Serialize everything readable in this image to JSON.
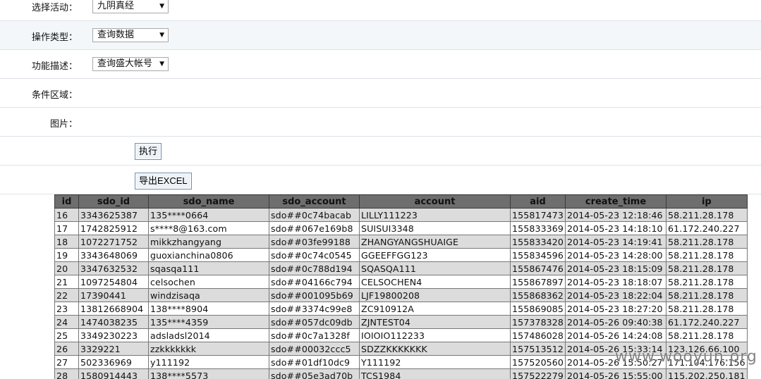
{
  "form": {
    "activity": {
      "label": "选择活动：",
      "value": "九阴真经"
    },
    "op_type": {
      "label": "操作类型：",
      "value": "查询数据"
    },
    "func_desc": {
      "label": "功能描述：",
      "value": "查询盛大帐号"
    },
    "condition": {
      "label": "条件区域："
    },
    "image": {
      "label": "图片："
    },
    "execute_label": "执行",
    "export_label": "导出EXCEL",
    "arrow_icon": "triangle-down-icon"
  },
  "table": {
    "headers": [
      "id",
      "sdo_id",
      "sdo_name",
      "sdo_account",
      "account",
      "aid",
      "create_time",
      "ip"
    ],
    "rows": [
      [
        "16",
        "3343625387",
        "135****0664",
        "sdo##0c74bacab",
        "LILLY111223",
        "155817473",
        "2014-05-23 12:18:46",
        "58.211.28.178"
      ],
      [
        "17",
        "1742825912",
        "s****8@163.com",
        "sdo##067e169b8",
        "SUISUI3348",
        "155833369",
        "2014-05-23 14:18:10",
        "61.172.240.227"
      ],
      [
        "18",
        "1072271752",
        "mikkzhangyang",
        "sdo##03fe99188",
        "ZHANGYANGSHUAIGE",
        "155833420",
        "2014-05-23 14:19:41",
        "58.211.28.178"
      ],
      [
        "19",
        "3343648069",
        "guoxianchina0806",
        "sdo##0c74c0545",
        "GGEEFFGG123",
        "155834596",
        "2014-05-23 14:28:00",
        "58.211.28.178"
      ],
      [
        "20",
        "3347632532",
        "sqasqa111",
        "sdo##0c788d194",
        "SQASQA111",
        "155867476",
        "2014-05-23 18:15:09",
        "58.211.28.178"
      ],
      [
        "21",
        "1097254804",
        "celsochen",
        "sdo##04166c794",
        "CELSOCHEN4",
        "155867897",
        "2014-05-23 18:18:07",
        "58.211.28.178"
      ],
      [
        "22",
        "17390441",
        "windzisaqa",
        "sdo##001095b69",
        "LJF19800208",
        "155868362",
        "2014-05-23 18:22:04",
        "58.211.28.178"
      ],
      [
        "23",
        "13812668904",
        "138****8904",
        "sdo##3374c99e8",
        "ZC910912A",
        "155869085",
        "2014-05-23 18:27:20",
        "58.211.28.178"
      ],
      [
        "24",
        "1474038235",
        "135****4359",
        "sdo##057dc09db",
        "ZJNTEST04",
        "157378328",
        "2014-05-26 09:40:38",
        "61.172.240.227"
      ],
      [
        "25",
        "3349230223",
        "adsladsl2014",
        "sdo##0c7a1328f",
        "IOIOIO112233",
        "157486028",
        "2014-05-26 14:24:08",
        "58.211.28.178"
      ],
      [
        "26",
        "3329221",
        "zzkkkkkkk",
        "sdo##00032ccc5",
        "SDZZKKKKKKK",
        "157513512",
        "2014-05-26 15:33:14",
        "123.126.66.100"
      ],
      [
        "27",
        "502336969",
        "y111192",
        "sdo##01df10dc9",
        "Y111192",
        "157520560",
        "2014-05-26 15:50:27",
        "171.104.176.156"
      ],
      [
        "28",
        "1580914443",
        "138****5573",
        "sdo##05e3ad70b",
        "TCS1984",
        "157522279",
        "2014-05-26 15:55:00",
        "115.202.250.181"
      ]
    ]
  },
  "watermark": "www.wooyun.org"
}
